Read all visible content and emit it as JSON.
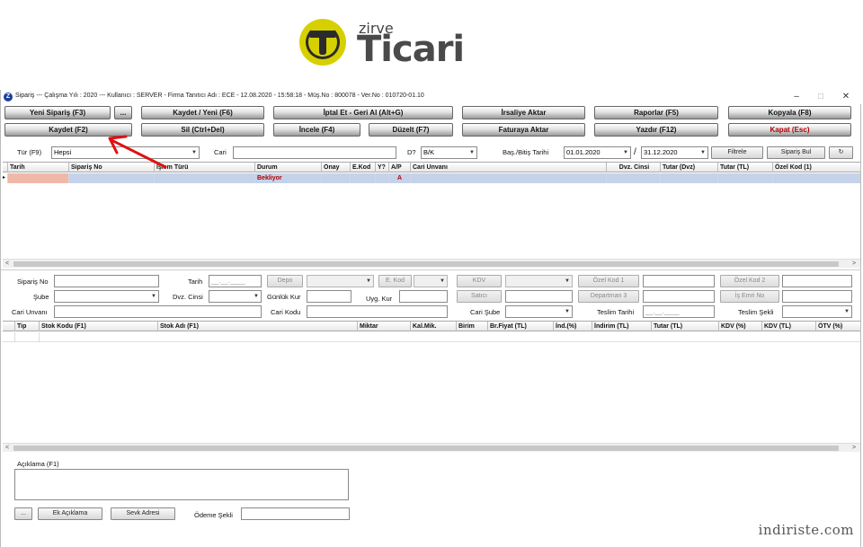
{
  "logo": {
    "small": "zirve",
    "big": "Ticari"
  },
  "window": {
    "title": "Sipariş  ---  Çalışma Yılı : 2020  ---  Kullanıcı : SERVER - Firma Tanıtıcı Adı : ECE - 12.08.2020 - 15:58:18 - Müş.No : 800078 - Ver.No : 010720-01.10",
    "minimize": "–",
    "maximize": "□",
    "close": "✕"
  },
  "toolbar": {
    "yeni_siparis": "Yeni Sipariş (F3)",
    "ellipsis": "...",
    "kaydet_yeni": "Kaydet / Yeni (F6)",
    "iptal": "İptal Et - Geri Al (Alt+G)",
    "irsaliye": "İrsaliye Aktar",
    "raporlar": "Raporlar (F5)",
    "kopyala": "Kopyala (F8)",
    "kaydet": "Kaydet (F2)",
    "sil": "Sil (Ctrl+Del)",
    "incele": "İncele (F4)",
    "duzelt": "Düzelt (F7)",
    "faturaya": "Faturaya Aktar",
    "yazdir": "Yazdır (F12)",
    "kapat": "Kapat (Esc)"
  },
  "filter": {
    "tur_label": "Tür (F9)",
    "tur_value": "Hepsi",
    "cari_label": "Cari",
    "cari_value": "",
    "d_label": "D?",
    "d_value": "B/K",
    "tarih_label": "Baş./Bitiş Tarihi",
    "bas_tarih": "01.01.2020",
    "slash": "/",
    "bitis_tarih": "31.12.2020",
    "filtrele": "Filtrele",
    "siparis_bul": "Sipariş Bul",
    "refresh": "↻"
  },
  "orders_grid": {
    "headers": [
      "Tarih",
      "Sipariş No",
      "İşlem Türü",
      "Durum",
      "Onay",
      "E.Kod",
      "Y?",
      "A/P",
      "Cari Unvanı",
      "Dvz. Cinsi",
      "Tutar (Dvz)",
      "Tutar (TL)",
      "Özel Kod (1)"
    ],
    "rows": [
      {
        "tarih": "",
        "siparis_no": "",
        "islem_turu": "",
        "durum": "Bekliyor",
        "onay": "",
        "ekod": "",
        "y": "",
        "ap": "A",
        "cari": "",
        "dvz": "",
        "tutar_dvz": "",
        "tutar_tl": "",
        "ozel": ""
      }
    ]
  },
  "form": {
    "siparis_no": "Sipariş No",
    "tarih": "Tarih",
    "tarih_value": "__.__.____",
    "depo": "Depo",
    "ekod": "E. Kod",
    "kdv": "KDV",
    "ozel_kod1": "Özel Kod 1",
    "ozel_kod2": "Özel Kod 2",
    "sube": "Şube",
    "dvz_cinsi": "Dvz. Cinsi",
    "gunluk_kur": "Günlük Kur",
    "satici": "Satıcı",
    "departman": "Departman 3",
    "is_emri": "İş Emri No",
    "cari_unvani": "Cari Unvanı",
    "uyg_kur": "Uyg. Kur",
    "cari_kodu": "Cari Kodu",
    "cari_sube": "Cari Şube",
    "teslim_tarihi": "Teslim Tarihi",
    "teslim_value": "__.__.____",
    "teslim_sekli": "Teslim Şekli"
  },
  "items_grid": {
    "headers": [
      "Tip",
      "Stok Kodu (F1)",
      "Stok Adı (F1)",
      "Miktar",
      "Kal.Mik.",
      "Birim",
      "Br.Fiyat (TL)",
      "İnd.(%)",
      "İndirim (TL)",
      "Tutar (TL)",
      "KDV (%)",
      "KDV (TL)",
      "ÖTV (%)"
    ]
  },
  "bottom": {
    "aciklama": "Açıklama (F1)",
    "ellipsis": "...",
    "ek_aciklama": "Ek Açıklama",
    "sevk_adresi": "Sevk Adresi",
    "odeme_sekli": "Ödeme Şekli"
  },
  "watermark": "indiriste.com",
  "colors": {
    "selected_row": "#c5d2ea",
    "selected_cell": "#f0b9a7",
    "status_text": "#b00000",
    "logo_yellow": "#d7d000"
  }
}
